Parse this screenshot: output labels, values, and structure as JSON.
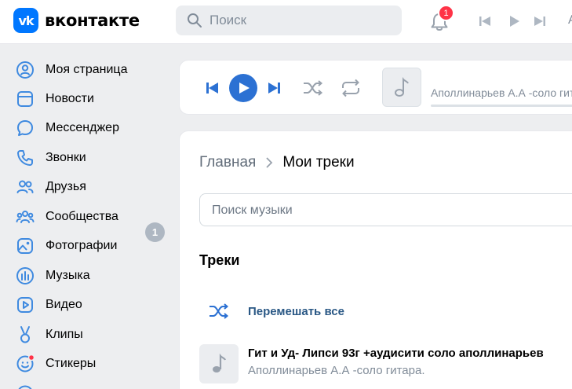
{
  "header": {
    "logo_mark": "vk",
    "logo_text": "вконтакте",
    "search_placeholder": "Поиск",
    "notification_count": "1",
    "player_letter": "А"
  },
  "sidebar": {
    "items": [
      {
        "label": "Моя страница",
        "icon": "user-circle-icon"
      },
      {
        "label": "Новости",
        "icon": "newsfeed-icon"
      },
      {
        "label": "Мессенджер",
        "icon": "message-icon"
      },
      {
        "label": "Звонки",
        "icon": "phone-icon"
      },
      {
        "label": "Друзья",
        "icon": "friends-icon"
      },
      {
        "label": "Сообщества",
        "icon": "communities-icon"
      },
      {
        "label": "Фотографии",
        "icon": "photo-icon"
      },
      {
        "label": "Музыка",
        "icon": "music-icon"
      },
      {
        "label": "Видео",
        "icon": "video-icon"
      },
      {
        "label": "Клипы",
        "icon": "clips-icon"
      },
      {
        "label": "Стикеры",
        "icon": "stickers-icon"
      }
    ],
    "friends_badge": "1"
  },
  "player": {
    "now_playing_artist": "Аполлинарьев А.А -соло гитара."
  },
  "main": {
    "breadcrumb_home": "Главная",
    "breadcrumb_current": "Мои треки",
    "search_placeholder": "Поиск музыки",
    "section_title": "Треки",
    "shuffle_label": "Перемешать все",
    "tracks": [
      {
        "title": "Гит и Уд- Липси 93г +аудисити соло аполлинарьев",
        "artist": "Аполлинарьев А.А -соло гитара."
      }
    ]
  },
  "colors": {
    "accent": "#0077ff",
    "player_accent": "#2c71d3",
    "link": "#2a5885",
    "notification": "#ff3347",
    "muted": "#818c99"
  }
}
